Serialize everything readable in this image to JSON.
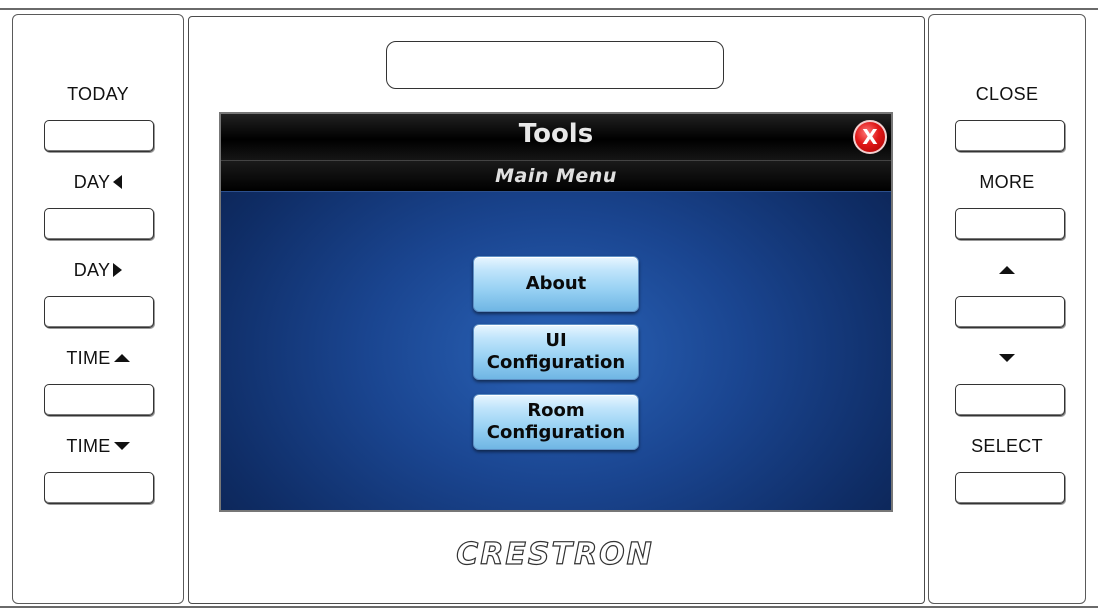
{
  "left_panel": {
    "items": [
      {
        "label": "TODAY",
        "arrow": ""
      },
      {
        "label": "DAY",
        "arrow": "left-triangle-icon"
      },
      {
        "label": "DAY",
        "arrow": "right-triangle-icon"
      },
      {
        "label": "TIME",
        "arrow": "up-triangle-icon"
      },
      {
        "label": "TIME",
        "arrow": "down-triangle-icon"
      }
    ]
  },
  "right_panel": {
    "items": [
      {
        "label": "CLOSE",
        "arrow": ""
      },
      {
        "label": "MORE",
        "arrow": ""
      },
      {
        "label": "",
        "arrow": "up-triangle-icon"
      },
      {
        "label": "",
        "arrow": "down-triangle-icon"
      },
      {
        "label": "SELECT",
        "arrow": ""
      }
    ]
  },
  "screen": {
    "title": "Tools",
    "subtitle": "Main Menu",
    "close_glyph": "X",
    "menu_buttons": [
      {
        "label": "About"
      },
      {
        "label": "UI\nConfiguration"
      },
      {
        "label": "Room\nConfiguration"
      }
    ]
  },
  "brand": "CRESTRON",
  "colors": {
    "screen_bg": "#1a4590",
    "title_bar": "#000000",
    "close_button": "#e01818",
    "menu_button": "#98d1f3"
  }
}
